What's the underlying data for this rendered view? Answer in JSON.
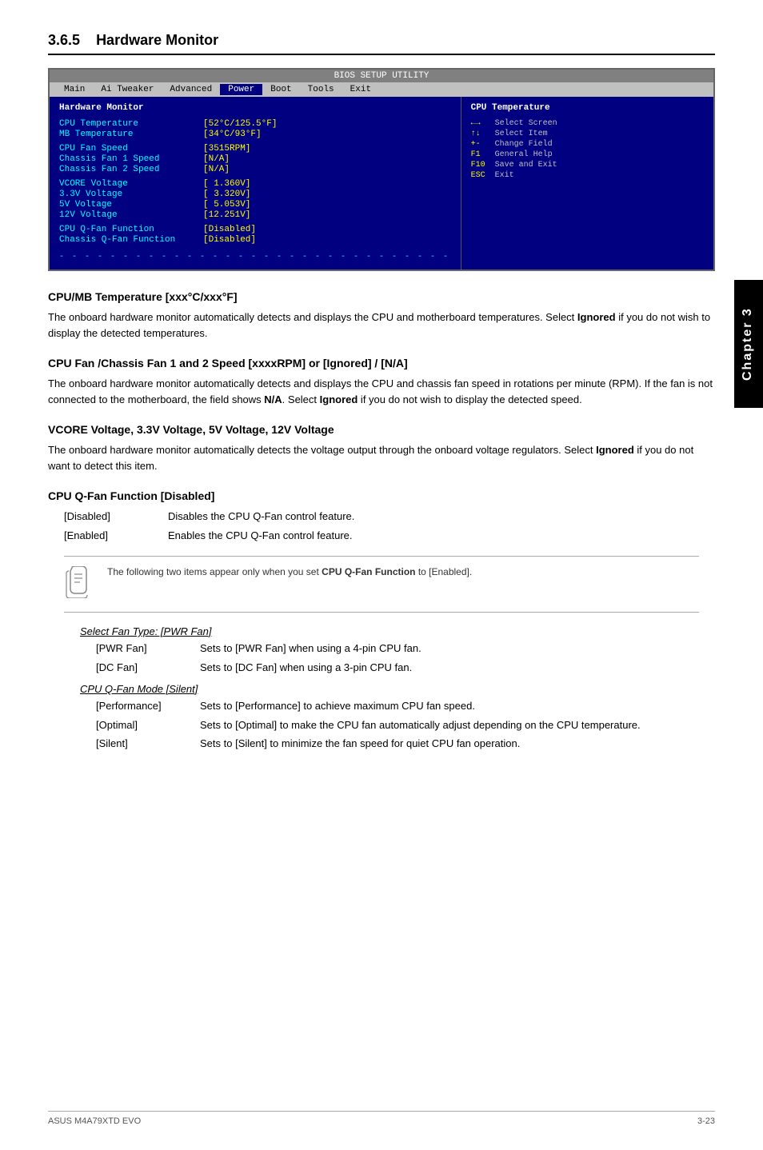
{
  "page": {
    "section": "3.6.5",
    "title": "Hardware Monitor"
  },
  "bios": {
    "title": "BIOS SETUP UTILITY",
    "tabs": [
      "Main",
      "Ai Tweaker",
      "Advanced",
      "Power",
      "Boot",
      "Tools",
      "Exit"
    ],
    "active_tab": "Power",
    "left_section_title": "Hardware Monitor",
    "right_section_title": "CPU Temperature",
    "rows": [
      {
        "label": "CPU Temperature",
        "value": "[52°C/125.5°F]"
      },
      {
        "label": "MB Temperature",
        "value": "[34°C/93°F]"
      },
      {
        "label": "CPU Fan Speed",
        "value": "[3515RPM]"
      },
      {
        "label": "Chassis Fan 1 Speed",
        "value": "[N/A]"
      },
      {
        "label": "Chassis Fan 2 Speed",
        "value": "[N/A]"
      },
      {
        "label": "VCORE Voltage",
        "value": "[ 1.360V]"
      },
      {
        "label": "3.3V Voltage",
        "value": "[ 3.320V]"
      },
      {
        "label": "5V Voltage",
        "value": "[ 5.053V]"
      },
      {
        "label": "12V Voltage",
        "value": "[12.251V]"
      },
      {
        "label": "CPU Q-Fan Function",
        "value": "[Disabled]"
      },
      {
        "label": "Chassis Q-Fan Function",
        "value": "[Disabled]"
      }
    ],
    "keys": [
      {
        "sym": "←→",
        "desc": "Select Screen"
      },
      {
        "sym": "↑↓",
        "desc": "Select Item"
      },
      {
        "sym": "+-",
        "desc": "Change Field"
      },
      {
        "sym": "F1",
        "desc": "General Help"
      },
      {
        "sym": "F10",
        "desc": "Save and Exit"
      },
      {
        "sym": "ESC",
        "desc": "Exit"
      }
    ]
  },
  "sections": [
    {
      "id": "cpu-mb-temp",
      "title": "CPU/MB Temperature [xxxºC/xxxºF]",
      "body": "The onboard hardware monitor automatically detects and displays the CPU and motherboard temperatures. Select Ignored if you do not wish to display the detected temperatures.",
      "bold_word": "Ignored"
    },
    {
      "id": "fan-speed",
      "title": "CPU Fan /Chassis Fan 1 and 2 Speed [xxxxRPM] or [Ignored] / [N/A]",
      "body": "The onboard hardware monitor automatically detects and displays the CPU and chassis fan speed in rotations per minute (RPM). If the fan is not connected to the motherboard, the field shows N/A. Select Ignored if you do not wish to display the detected speed.",
      "bold_words": [
        "N/A",
        "Ignored"
      ]
    },
    {
      "id": "voltage",
      "title": "VCORE Voltage, 3.3V Voltage, 5V Voltage, 12V Voltage",
      "body": "The onboard hardware monitor automatically detects the voltage output through the onboard voltage regulators. Select Ignored if you do not want to detect this item.",
      "bold_word": "Ignored"
    },
    {
      "id": "cpu-qfan",
      "title": "CPU Q-Fan Function [Disabled]",
      "defs": [
        {
          "term": "[Disabled]",
          "desc": "Disables the CPU Q-Fan control feature."
        },
        {
          "term": "[Enabled]",
          "desc": "Enables the CPU Q-Fan control feature."
        }
      ]
    }
  ],
  "note": {
    "text": "The following two items appear only when you set CPU Q-Fan Function to [Enabled].",
    "bold_part": "CPU Q-Fan Function"
  },
  "sub_sections": [
    {
      "title": "Select Fan Type: [PWR Fan]",
      "defs": [
        {
          "term": "[PWR Fan]",
          "desc": "Sets to [PWR Fan] when using a 4-pin CPU fan."
        },
        {
          "term": "[DC Fan]",
          "desc": "Sets to [DC Fan] when using a 3-pin CPU fan."
        }
      ]
    },
    {
      "title": "CPU Q-Fan Mode [Silent]",
      "defs": [
        {
          "term": "[Performance]",
          "desc": "Sets to [Performance] to achieve maximum CPU fan speed."
        },
        {
          "term": "[Optimal]",
          "desc": "Sets to [Optimal] to make the CPU fan automatically adjust depending on the CPU temperature."
        },
        {
          "term": "[Silent]",
          "desc": "Sets to [Silent] to minimize the fan speed for quiet CPU fan operation."
        }
      ]
    }
  ],
  "chapter": {
    "label": "Chapter 3"
  },
  "footer": {
    "left": "ASUS M4A79XTD EVO",
    "right": "3-23"
  }
}
